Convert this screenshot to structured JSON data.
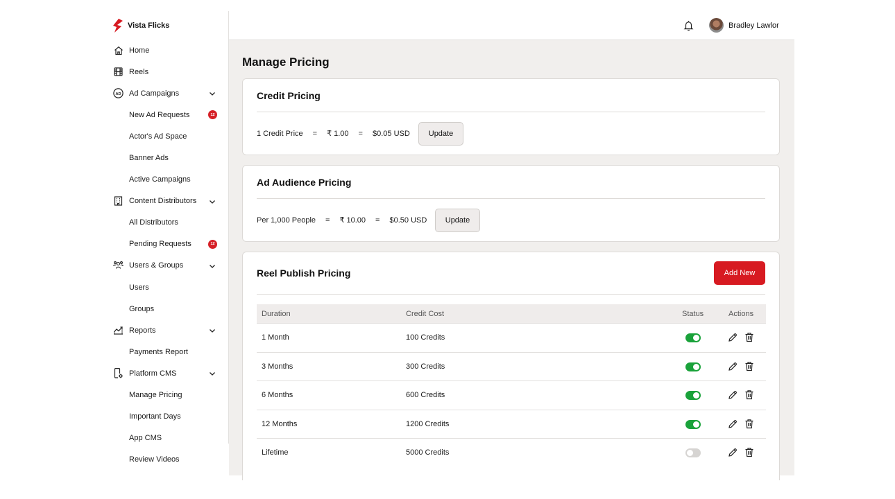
{
  "brand": {
    "name": "Vista Flicks",
    "accent": "#d71a21"
  },
  "topbar": {
    "user_name": "Bradley Lawlor",
    "bell_icon": "bell-icon"
  },
  "sidebar": {
    "items": [
      {
        "label": "Home",
        "icon": "home-icon"
      },
      {
        "label": "Reels",
        "icon": "film-icon"
      },
      {
        "label": "Ad Campaigns",
        "icon": "ad-icon",
        "expandable": true
      },
      {
        "label": "New Ad Requests",
        "sub": true,
        "badge": "12"
      },
      {
        "label": "Actor's Ad Space",
        "sub": true
      },
      {
        "label": "Banner Ads",
        "sub": true
      },
      {
        "label": "Active Campaigns",
        "sub": true
      },
      {
        "label": "Content Distributors",
        "icon": "building-icon",
        "expandable": true
      },
      {
        "label": "All Distributors",
        "sub": true
      },
      {
        "label": "Pending Requests",
        "sub": true,
        "badge": "12"
      },
      {
        "label": "Users & Groups",
        "icon": "users-icon",
        "expandable": true
      },
      {
        "label": "Users",
        "sub": true
      },
      {
        "label": "Groups",
        "sub": true
      },
      {
        "label": "Reports",
        "icon": "reports-icon",
        "expandable": true
      },
      {
        "label": "Payments Report",
        "sub": true
      },
      {
        "label": "Platform CMS",
        "icon": "phone-settings-icon",
        "expandable": true
      },
      {
        "label": "Manage Pricing",
        "sub": true
      },
      {
        "label": "Important Days",
        "sub": true
      },
      {
        "label": "App CMS",
        "sub": true
      },
      {
        "label": "Review Videos",
        "sub": true
      }
    ]
  },
  "main": {
    "title": "Manage Pricing",
    "credit_pricing": {
      "title": "Credit Pricing",
      "label": "1 Credit Price",
      "eq1": "=",
      "inr": "₹ 1.00",
      "eq2": "=",
      "usd": "$0.05 USD",
      "button": "Update"
    },
    "audience_pricing": {
      "title": "Ad Audience Pricing",
      "label": "Per 1,000 People",
      "eq1": "=",
      "inr": "₹ 10.00",
      "eq2": "=",
      "usd": "$0.50 USD",
      "button": "Update"
    },
    "reel_pricing": {
      "title": "Reel Publish Pricing",
      "add_button": "Add New",
      "columns": [
        "Duration",
        "Credit Cost",
        "Status",
        "Actions"
      ],
      "rows": [
        {
          "duration": "1 Month",
          "cost": "100 Credits",
          "active": true
        },
        {
          "duration": "3 Months",
          "cost": "300 Credits",
          "active": true
        },
        {
          "duration": "6 Months",
          "cost": "600 Credits",
          "active": true
        },
        {
          "duration": "12 Months",
          "cost": "1200 Credits",
          "active": true
        },
        {
          "duration": "Lifetime",
          "cost": "5000 Credits",
          "active": false
        }
      ]
    }
  }
}
